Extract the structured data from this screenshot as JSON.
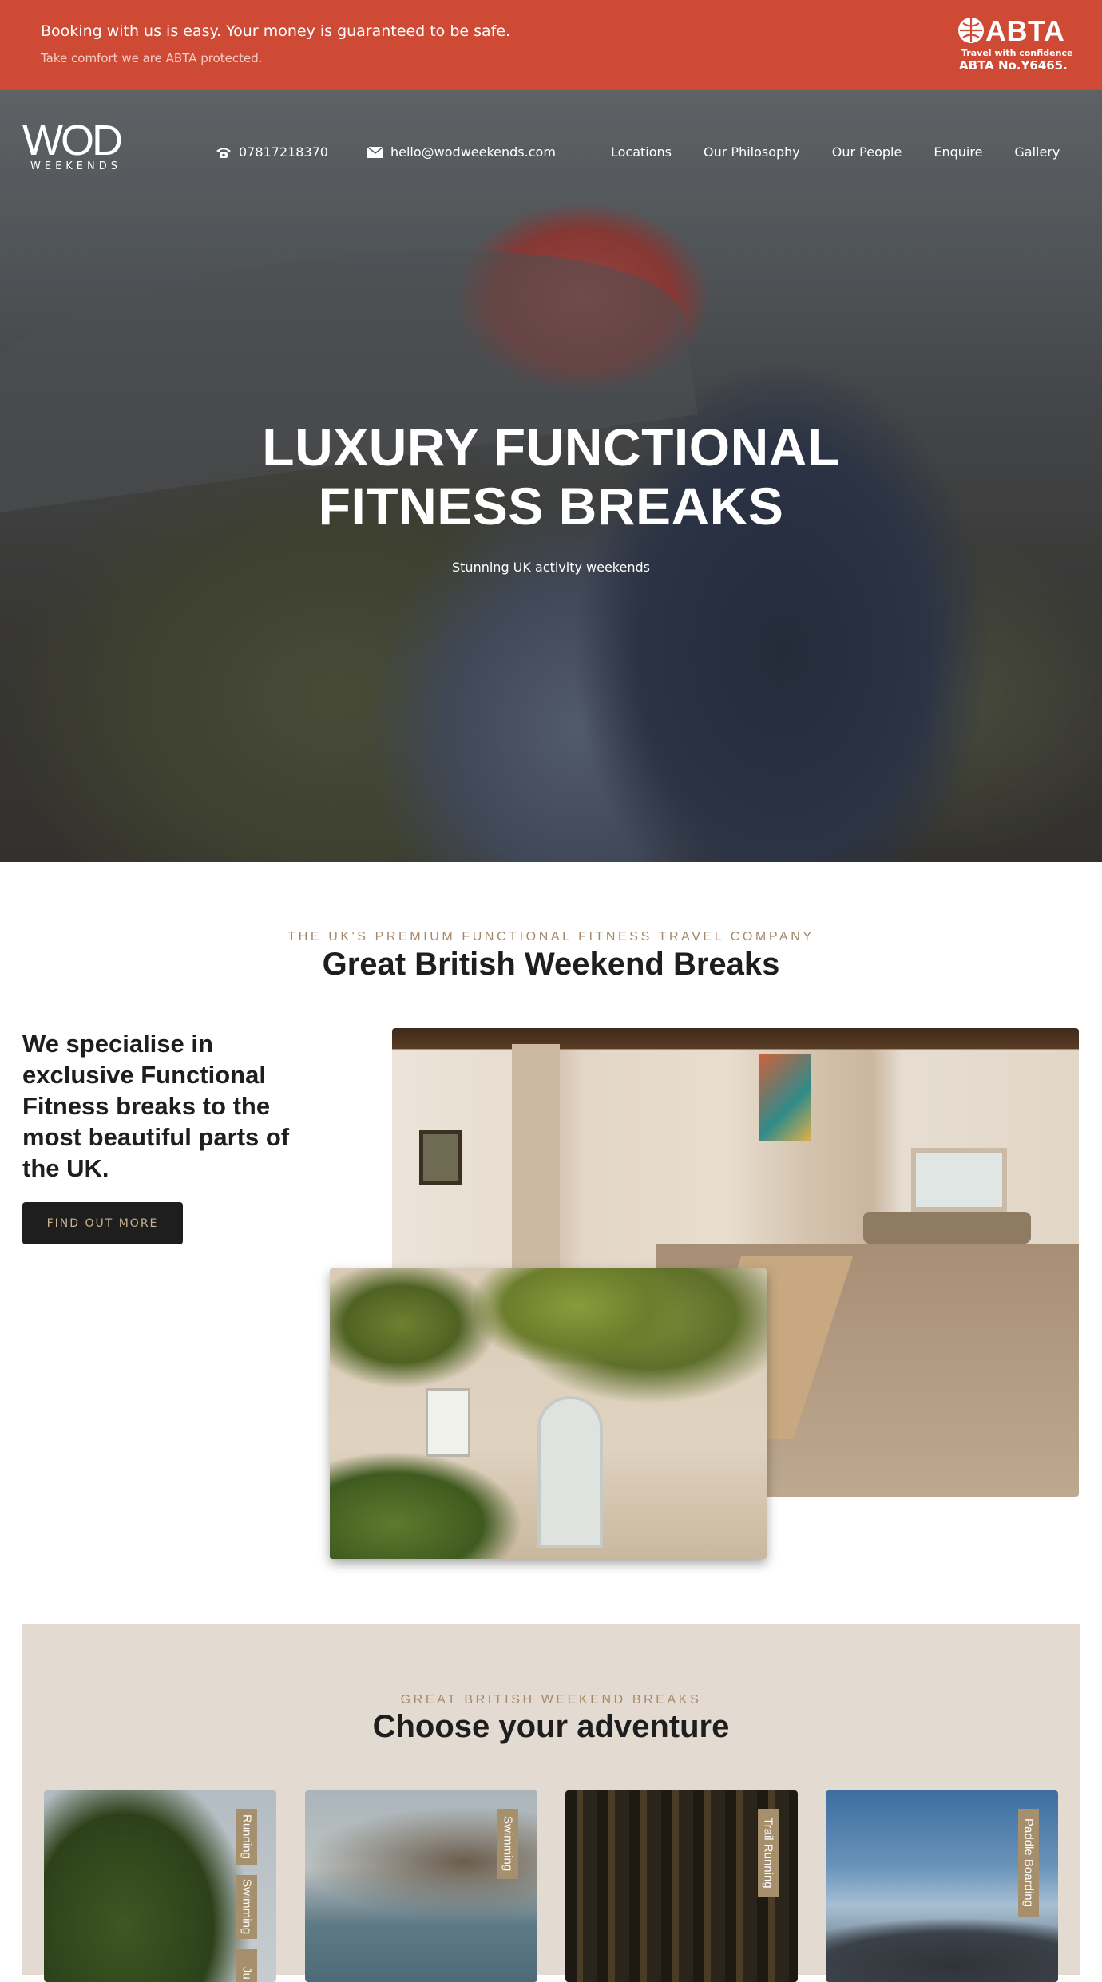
{
  "banner": {
    "line1": "Booking with us is easy. Your money is guaranteed to be safe.",
    "line2": "Take comfort we are ABTA protected.",
    "abta_word": "ABTA",
    "abta_tagline": "Travel with confidence",
    "abta_number": "ABTA No.Y6465."
  },
  "header": {
    "logo_main": "WOD",
    "logo_sub": "WEEKENDS",
    "phone": "07817218370",
    "email": "hello@wodweekends.com",
    "nav": [
      "Locations",
      "Our Philosophy",
      "Our People",
      "Enquire",
      "Gallery"
    ]
  },
  "hero": {
    "title_line1": "LUXURY FUNCTIONAL",
    "title_line2": "FITNESS BREAKS",
    "subtitle": "Stunning UK activity weekends"
  },
  "intro": {
    "eyebrow": "THE UK'S PREMIUM FUNCTIONAL FITNESS TRAVEL COMPANY",
    "title": "Great British Weekend Breaks",
    "lead": "We specialise in exclusive Functional Fitness breaks to the most beautiful parts of the UK.",
    "button": "FIND OUT MORE"
  },
  "adventure": {
    "eyebrow": "GREAT BRITISH WEEKEND BREAKS",
    "title": "Choose your adventure",
    "cards": [
      {
        "tags": [
          "Running",
          "Swimming",
          "Ju"
        ]
      },
      {
        "tags": [
          "Swimming"
        ]
      },
      {
        "tags": [
          "Trail Running"
        ]
      },
      {
        "tags": [
          "Paddle Boarding"
        ]
      }
    ]
  },
  "colors": {
    "banner": "#cf4a35",
    "accent_gold": "#a3896b",
    "button_dark": "#1e1e1e",
    "section_beige": "#e3dbd1",
    "tag_bg": "#a68f6d"
  },
  "icons": [
    "abta-globe-icon",
    "phone-icon",
    "mail-icon"
  ]
}
